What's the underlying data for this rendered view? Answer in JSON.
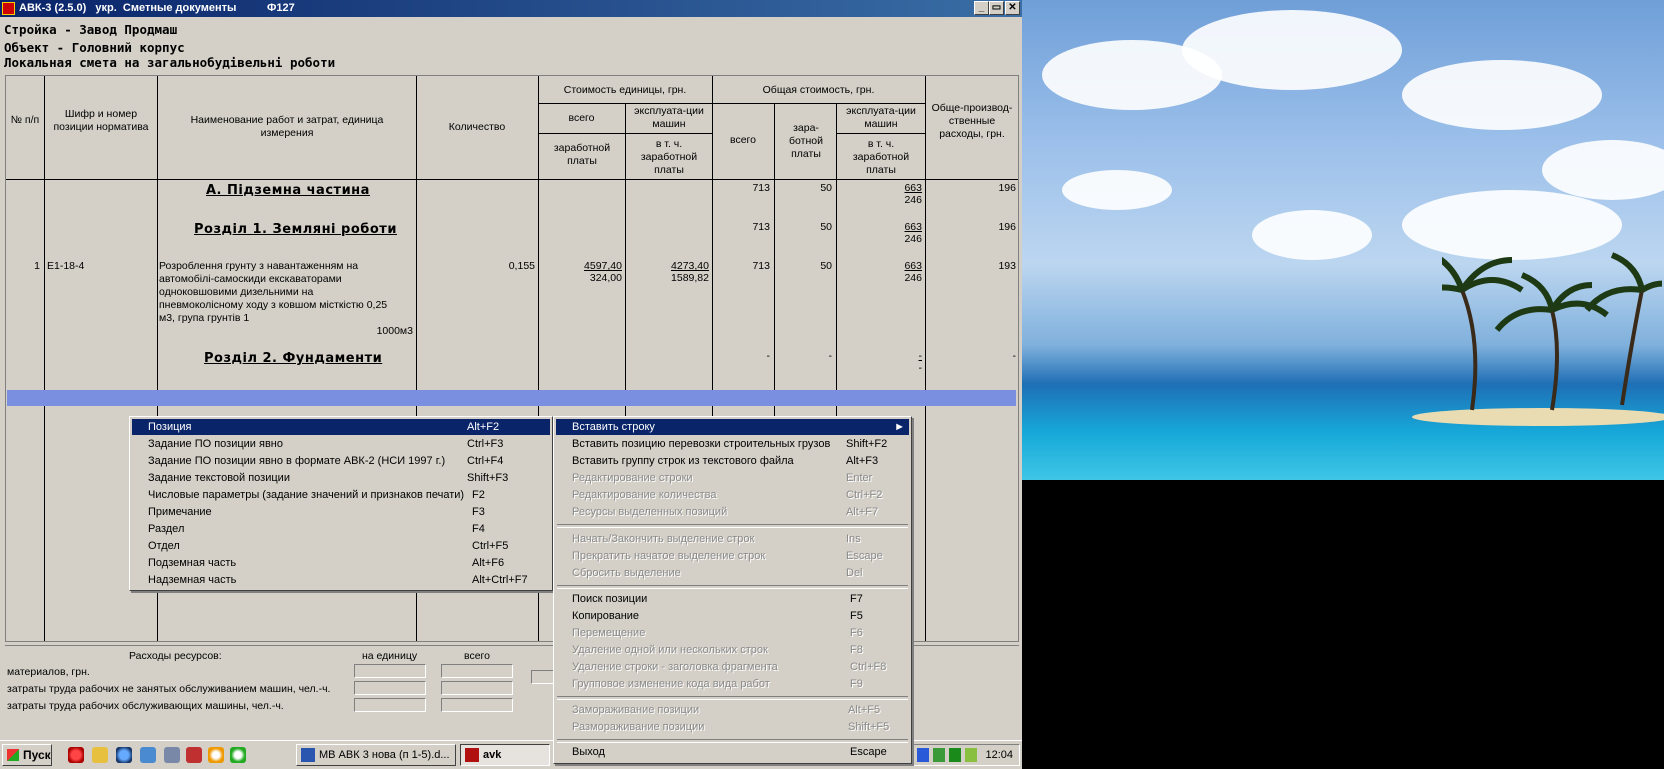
{
  "window": {
    "title": "АВК-3 (2.5.0)   укр.  Сметные документы          Ф127",
    "controls": [
      "_",
      "▭",
      "✕"
    ]
  },
  "header": {
    "line1": "Стройка - Завод Продмаш",
    "line2": "Объект - Головний корпус",
    "line3": "Локальная смета на загальнобудівельні роботи"
  },
  "columns": {
    "num": "№ п/п",
    "code": "Шифр и номер позиции норматива",
    "name": "Наименование работ и затрат, единица измерения",
    "qty": "Количество",
    "unit_cost": "Стоимость единицы, грн.",
    "total_cost": "Общая стоимость, грн.",
    "unit_all": "всего",
    "unit_machine": "эксплуата-ции машин",
    "unit_wage": "заработной платы",
    "unit_machine_wage": "в т. ч. заработной платы",
    "total_all": "всего",
    "total_wage": "зара-ботной платы",
    "total_machine": "эксплуата-ции машин",
    "total_machine_wage": "в т. ч. заработной платы",
    "overhead": "Обще-производ-ственные расходы, грн."
  },
  "rows": {
    "partA": {
      "title": "А.   Підземна частина",
      "total": "713",
      "wage": "50",
      "mach": "663",
      "mach_wage": "246",
      "overhead": "196"
    },
    "sec1": {
      "title": "Розділ 1. Земляні роботи",
      "total": "713",
      "wage": "50",
      "mach": "663",
      "mach_wage": "246",
      "overhead": "196"
    },
    "item1": {
      "num": "1",
      "code": "Е1-18-4",
      "name_lines": [
        "Розроблення грунту з навантаженням на",
        "автомобілі-самоскиди екскаваторами",
        "одноковшовими дизельними на",
        "пневмоколісному ходу з ковшом місткістю 0,25",
        "м3, група грунтів 1"
      ],
      "unit": "1000м3",
      "qty": "0,155",
      "unit_all": "4597,40",
      "unit_wage": "324,00",
      "unit_mach": "4273,40",
      "unit_mach_wage": "1589,82",
      "total": "713",
      "wage": "50",
      "mach": "663",
      "mach_wage": "246",
      "overhead": "193"
    },
    "sec2": {
      "title": "Розділ 2. Фундаменти",
      "total": "-",
      "wage": "-",
      "mach": "-",
      "mach_wage": "-",
      "overhead": "-"
    }
  },
  "resources": {
    "title": "Расходы ресурсов:",
    "per_unit": "на единицу",
    "all": "всего",
    "materials": "материалов, грн.",
    "labor_nonmach": "затраты труда рабочих не занятых обслуживанием машин, чел.-ч.",
    "labor_mach": "затраты труда рабочих обслуживающих машины, чел.-ч."
  },
  "submenu": {
    "items": [
      {
        "label": "Позиция",
        "shortcut": "Alt+F2"
      },
      {
        "label": "Задание ПО позиции явно",
        "shortcut": "Ctrl+F3"
      },
      {
        "label": "Задание ПО позиции явно в формате АВК-2 (НСИ 1997 г.)",
        "shortcut": "Ctrl+F4"
      },
      {
        "label": "Задание текстовой позиции",
        "shortcut": "Shift+F3"
      },
      {
        "label": "Числовые параметры (задание значений и признаков печати)",
        "shortcut": "F2"
      },
      {
        "label": "Примечание",
        "shortcut": "F3"
      },
      {
        "label": "Раздел",
        "shortcut": "F4"
      },
      {
        "label": "Отдел",
        "shortcut": "Ctrl+F5"
      },
      {
        "label": "Подземная часть",
        "shortcut": "Alt+F6"
      },
      {
        "label": "Надземная часть",
        "shortcut": "Alt+Ctrl+F7"
      }
    ]
  },
  "context_menu": {
    "items": [
      {
        "label": "Вставить строку",
        "shortcut": "",
        "arrow": "►"
      },
      {
        "label": "Вставить позицию перевозки строительных грузов",
        "shortcut": "Shift+F2"
      },
      {
        "label": "Вставить группу строк из текстового файла",
        "shortcut": "Alt+F3"
      },
      {
        "label": "Редактирование строки",
        "shortcut": "Enter"
      },
      {
        "label": "Редактирование количества",
        "shortcut": "Ctrl+F2"
      },
      {
        "label": "Ресурсы выделенных позиций",
        "shortcut": "Alt+F7"
      },
      {
        "label": "Начать/Закончить выделение строк",
        "shortcut": "Ins"
      },
      {
        "label": "Прекратить начатое выделение строк",
        "shortcut": "Escape"
      },
      {
        "label": "Сбросить выделение",
        "shortcut": "Del"
      },
      {
        "label": "Поиск позиции",
        "shortcut": "F7"
      },
      {
        "label": "Копирование",
        "shortcut": "F5"
      },
      {
        "label": "Перемещение",
        "shortcut": "F6"
      },
      {
        "label": "Удаление одной или нескольких строк",
        "shortcut": "F8"
      },
      {
        "label": "Удаление строки - заголовка фрагмента",
        "shortcut": "Ctrl+F8"
      },
      {
        "label": "Групповое изменение кода вида работ",
        "shortcut": "F9"
      },
      {
        "label": "Замораживание позиции",
        "shortcut": "Alt+F5"
      },
      {
        "label": "Размораживание позиции",
        "shortcut": "Shift+F5"
      },
      {
        "label": "Выход",
        "shortcut": "Escape"
      }
    ]
  },
  "taskbar": {
    "start": "Пуск",
    "task1": "МВ АВК 3 нова (п 1-5).d...",
    "task2": "avk",
    "clock": "12:04"
  },
  "colors": {
    "title_bar": "#0a246a",
    "selection_row": "#7b8fe0",
    "menu_highlight": "#0a246a",
    "window_bg": "#d4d0c8"
  }
}
